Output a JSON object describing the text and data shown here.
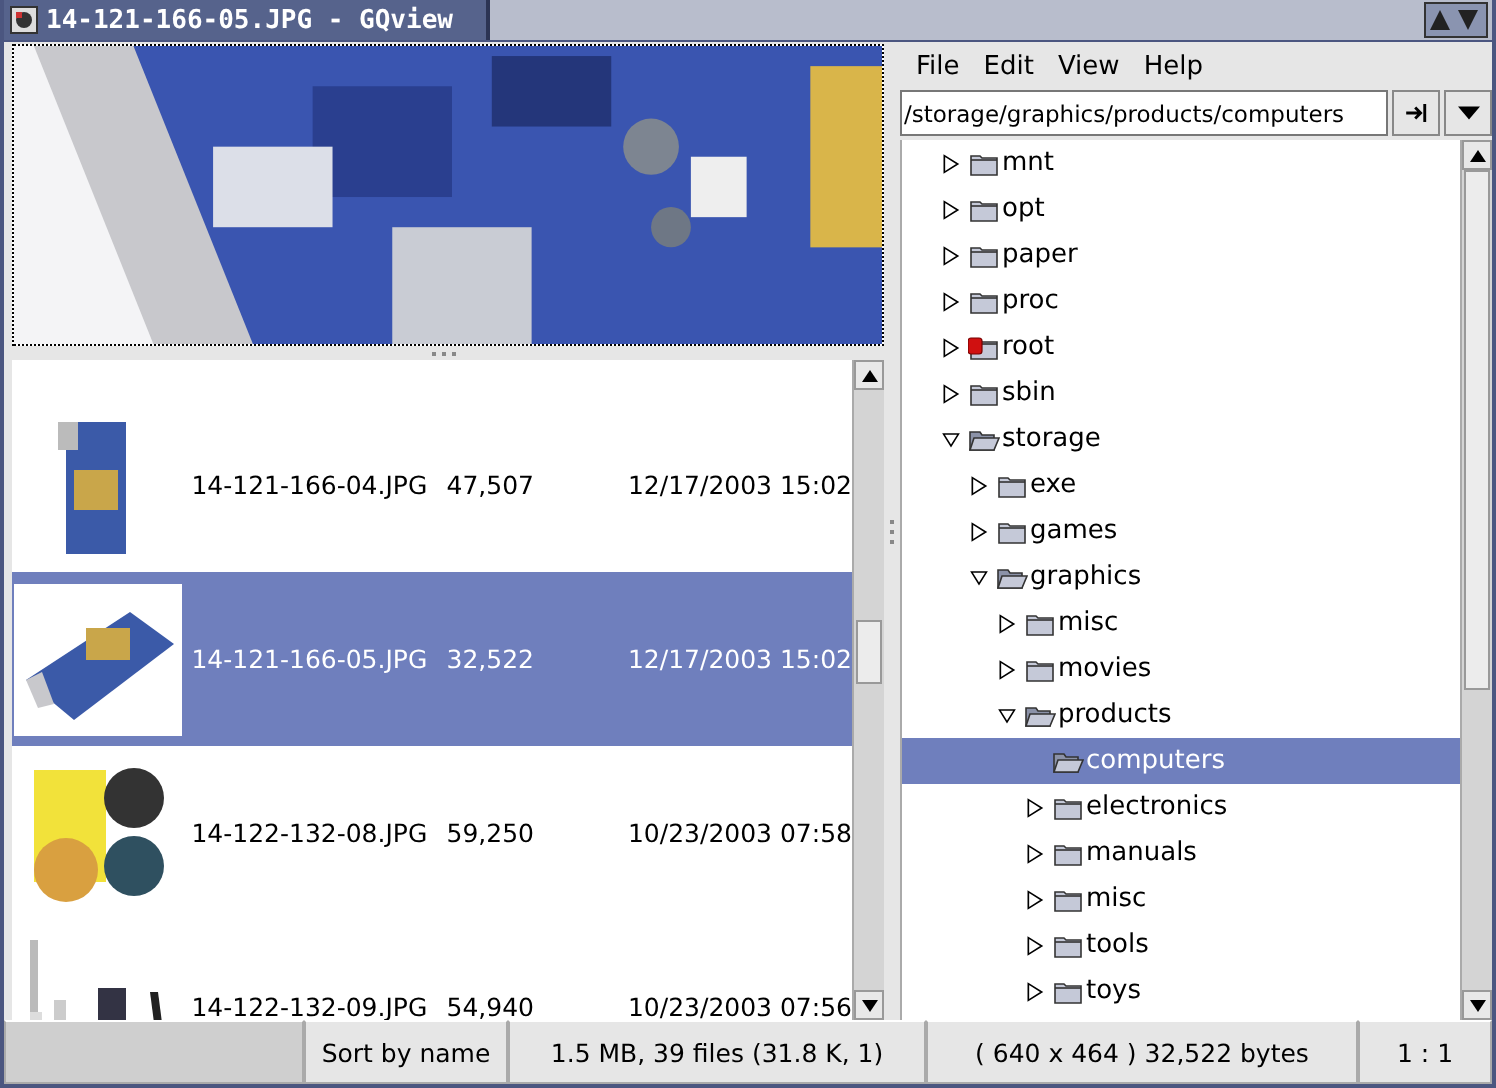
{
  "window": {
    "title": "14-121-166-05.JPG - GQview"
  },
  "menu": [
    "File",
    "Edit",
    "View",
    "Help"
  ],
  "path_field": {
    "value": "/storage/graphics/products/computers"
  },
  "files": [
    {
      "name": "14-121-166-04.JPG",
      "size": "47,507",
      "date": "12/17/2003 15:02",
      "selected": false
    },
    {
      "name": "14-121-166-05.JPG",
      "size": "32,522",
      "date": "12/17/2003 15:02",
      "selected": true
    },
    {
      "name": "14-122-132-08.JPG",
      "size": "59,250",
      "date": "10/23/2003 07:58",
      "selected": false
    },
    {
      "name": "14-122-132-09.JPG",
      "size": "54,940",
      "date": "10/23/2003 07:56",
      "selected": false
    }
  ],
  "tree": [
    {
      "name": "mnt",
      "expandable": true,
      "expanded": false,
      "locked": false,
      "selected": false
    },
    {
      "name": "opt",
      "expandable": true,
      "expanded": false,
      "locked": false,
      "selected": false
    },
    {
      "name": "paper",
      "expandable": true,
      "expanded": false,
      "locked": false,
      "selected": false
    },
    {
      "name": "proc",
      "expandable": true,
      "expanded": false,
      "locked": false,
      "selected": false
    },
    {
      "name": "root",
      "expandable": true,
      "expanded": false,
      "locked": true,
      "selected": false
    },
    {
      "name": "sbin",
      "expandable": true,
      "expanded": false,
      "locked": false,
      "selected": false
    },
    {
      "name": "storage",
      "expandable": true,
      "expanded": true,
      "locked": false,
      "selected": false,
      "children": [
        {
          "name": "exe",
          "expandable": true,
          "expanded": false,
          "locked": false,
          "selected": false
        },
        {
          "name": "games",
          "expandable": true,
          "expanded": false,
          "locked": false,
          "selected": false
        },
        {
          "name": "graphics",
          "expandable": true,
          "expanded": true,
          "locked": false,
          "selected": false,
          "children": [
            {
              "name": "misc",
              "expandable": true,
              "expanded": false,
              "locked": false,
              "selected": false
            },
            {
              "name": "movies",
              "expandable": true,
              "expanded": false,
              "locked": false,
              "selected": false
            },
            {
              "name": "products",
              "expandable": true,
              "expanded": true,
              "locked": false,
              "selected": false,
              "children": [
                {
                  "name": "computers",
                  "expandable": false,
                  "expanded": true,
                  "locked": false,
                  "selected": true
                },
                {
                  "name": "electronics",
                  "expandable": true,
                  "expanded": false,
                  "locked": false,
                  "selected": false
                },
                {
                  "name": "manuals",
                  "expandable": true,
                  "expanded": false,
                  "locked": false,
                  "selected": false
                },
                {
                  "name": "misc",
                  "expandable": true,
                  "expanded": false,
                  "locked": false,
                  "selected": false
                },
                {
                  "name": "tools",
                  "expandable": true,
                  "expanded": false,
                  "locked": false,
                  "selected": false
                },
                {
                  "name": "toys",
                  "expandable": true,
                  "expanded": false,
                  "locked": false,
                  "selected": false
                }
              ]
            }
          ]
        }
      ]
    }
  ],
  "status_bar": {
    "sort": "Sort by name",
    "totals": "1.5 MB, 39 files (31.8 K, 1)",
    "image_info": "( 640 x 464 ) 32,522 bytes",
    "zoom": "1 : 1"
  }
}
